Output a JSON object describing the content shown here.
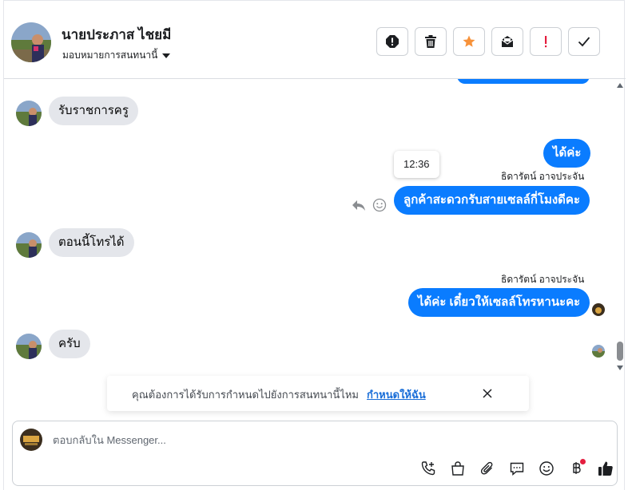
{
  "header": {
    "contact_name": "นายประภาส ไชยมี",
    "assign_label": "มอบหมายการสนทนานี้",
    "actions": [
      {
        "name": "spam-icon"
      },
      {
        "name": "trash-icon"
      },
      {
        "name": "star-icon"
      },
      {
        "name": "mark-unread-icon"
      },
      {
        "name": "follow-up-icon"
      },
      {
        "name": "done-icon"
      }
    ]
  },
  "messages": [
    {
      "direction": "in",
      "text": "รับราชการครู"
    },
    {
      "direction": "out",
      "text": "ได้ค่ะ"
    },
    {
      "direction": "out",
      "sender": "ธิดารัตน์ อาจประจัน",
      "text": "ลูกค้าสะดวกรับสายเซลล์กี่โมงดีคะ",
      "tooltip_time": "12:36"
    },
    {
      "direction": "in",
      "text": "ตอนนี้โทรได้"
    },
    {
      "direction": "out",
      "sender": "ธิดารัตน์ อาจประจัน",
      "text": "ได้ค่ะ เดี๋ยวให้เซลล์โทรหานะคะ"
    },
    {
      "direction": "in",
      "text": "ครับ"
    }
  ],
  "notice": {
    "text": "คุณต้องการได้รับการกำหนดไปยังการสนทนานี้ไหม",
    "link": "กำหนดให้ฉัน"
  },
  "composer": {
    "placeholder": "ตอบกลับใน Messenger...",
    "tools": [
      "call-add-icon",
      "shopping-bag-icon",
      "paperclip-icon",
      "chat-bubble-icon",
      "emoji-icon",
      "baht-icon",
      "like-icon"
    ]
  },
  "colors": {
    "accent": "#0a7cff",
    "incoming_bubble": "#e4e6eb",
    "star": "#f7923a",
    "alert": "#e41e3f",
    "link": "#1a6ed8"
  }
}
